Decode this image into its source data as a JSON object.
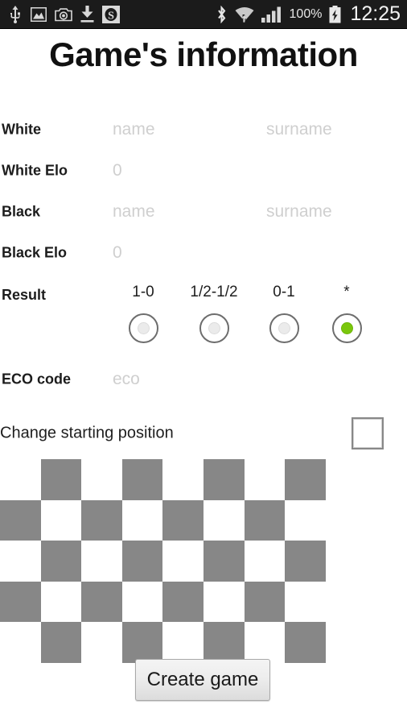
{
  "statusbar": {
    "left_icons": [
      "usb-icon",
      "gallery-image-icon",
      "camera-icon",
      "download-icon",
      "s-app-icon"
    ],
    "right_icons": [
      "bluetooth-icon",
      "wifi-icon",
      "signal-bars-icon",
      "battery-charging-icon"
    ],
    "battery_text": "100%",
    "clock": "12:25"
  },
  "header": {
    "title": "Game's information"
  },
  "form": {
    "rows": [
      {
        "label": "White",
        "name_placeholder": "name",
        "surname_placeholder": "surname"
      },
      {
        "label": "White Elo",
        "value_placeholder": "0"
      },
      {
        "label": "Black",
        "name_placeholder": "name",
        "surname_placeholder": "surname"
      },
      {
        "label": "Black Elo",
        "value_placeholder": "0"
      }
    ],
    "eco": {
      "label": "ECO code",
      "placeholder": "eco"
    }
  },
  "result": {
    "label": "Result",
    "options": [
      {
        "text": "1-0",
        "selected": false
      },
      {
        "text": "1/2-1/2",
        "selected": false
      },
      {
        "text": "0-1",
        "selected": false
      },
      {
        "text": "*",
        "selected": true
      }
    ],
    "selected_value": "*",
    "selected_color": "#7ac70c"
  },
  "change_position": {
    "label": "Change starting position",
    "checked": false
  },
  "chessboard": {
    "columns": 8,
    "visible_rows": 5,
    "light_color": "#ffffff",
    "dark_color": "#878787",
    "top_left_is_light": true
  },
  "actions": {
    "create_label": "Create game"
  }
}
